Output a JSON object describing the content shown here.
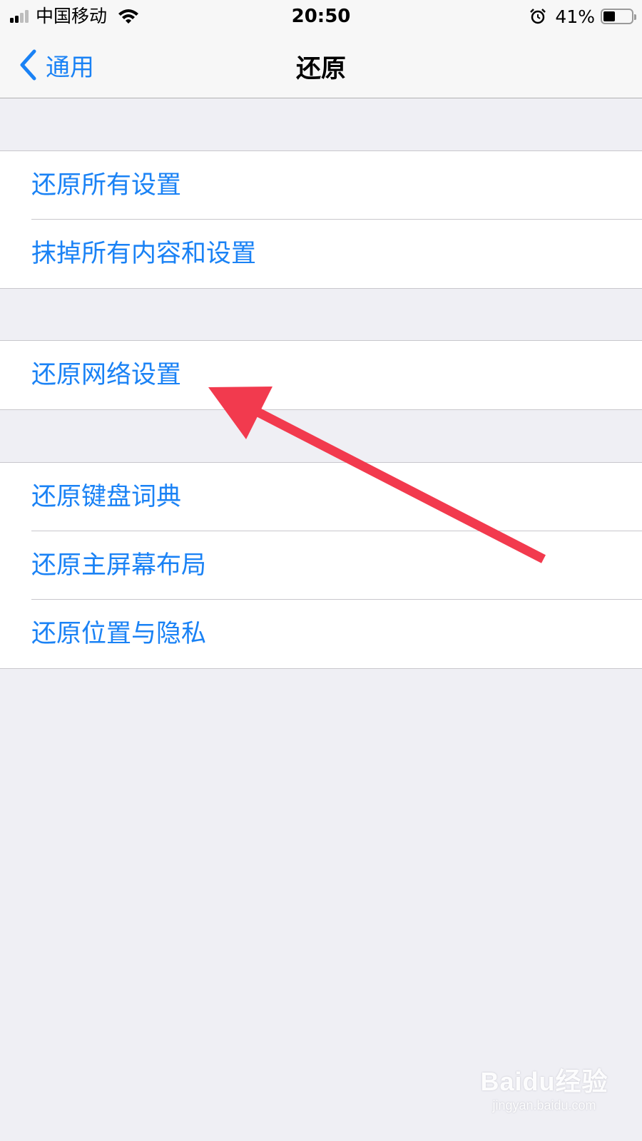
{
  "status_bar": {
    "carrier": "中国移动",
    "time": "20:50",
    "battery_percent": "41%",
    "battery_level": 0.41
  },
  "nav": {
    "back_label": "通用",
    "title": "还原"
  },
  "groups": [
    {
      "items": [
        {
          "label": "还原所有设置"
        },
        {
          "label": "抹掉所有内容和设置"
        }
      ]
    },
    {
      "items": [
        {
          "label": "还原网络设置"
        }
      ]
    },
    {
      "items": [
        {
          "label": "还原键盘词典"
        },
        {
          "label": "还原主屏幕布局"
        },
        {
          "label": "还原位置与隐私"
        }
      ]
    }
  ],
  "watermark": {
    "logo": "Baidu经验",
    "url": "jingyan.baidu.com"
  },
  "colors": {
    "accent": "#1a82f5",
    "background": "#efeff4",
    "annotation_arrow": "#f23a4e"
  },
  "icons": [
    "cellular-signal-icon",
    "wifi-icon",
    "alarm-icon",
    "battery-icon",
    "chevron-left-icon",
    "annotation-arrow"
  ]
}
